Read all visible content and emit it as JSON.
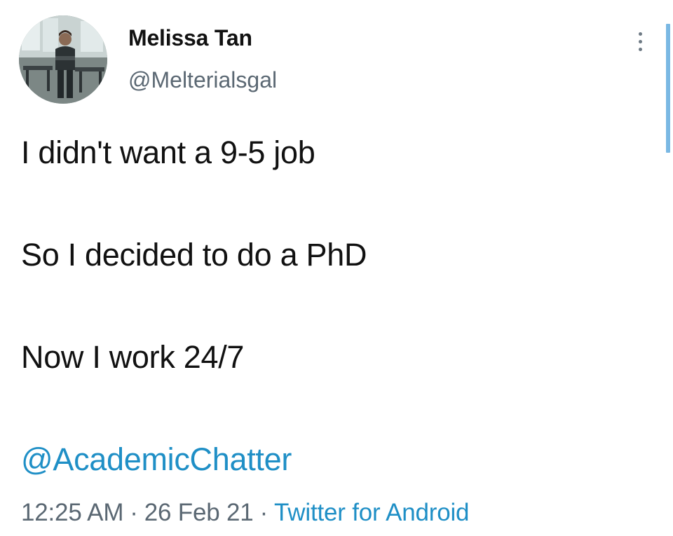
{
  "tweet": {
    "author": {
      "name": "Melissa Tan",
      "handle": "@Melterialsgal"
    },
    "text_lines": [
      "I didn't want a 9-5 job",
      "So I decided to do a PhD",
      "Now I work 24/7"
    ],
    "mention": "@AcademicChatter",
    "time": "12:25 AM",
    "date": "26 Feb 21",
    "separator": "·",
    "source": "Twitter for Android",
    "more_icon": "more-vertical-icon"
  },
  "colors": {
    "link": "#1f8fc6",
    "secondary_text": "#5b6873",
    "primary_text": "#111111"
  }
}
